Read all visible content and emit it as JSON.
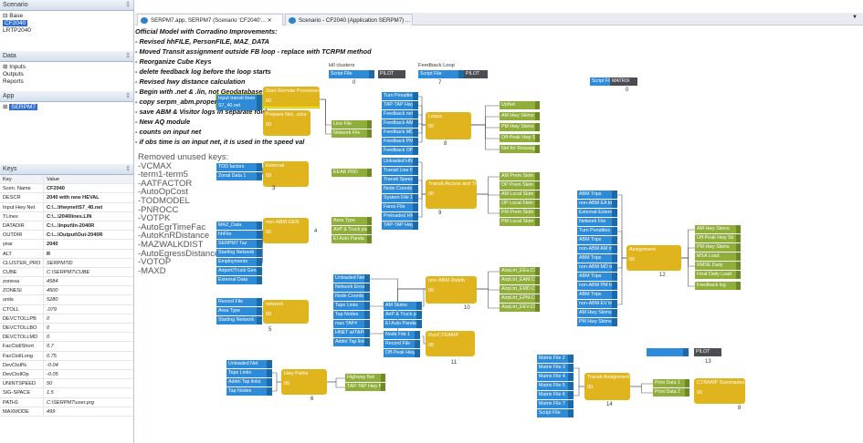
{
  "panels": {
    "scenario": "Scenario",
    "data": "Data",
    "app": "App",
    "keys": "Keys"
  },
  "scenario_tree": [
    "Base",
    "CF2040",
    "LRTP2040"
  ],
  "data_tree": [
    "Inputs",
    "Outputs",
    "Reports"
  ],
  "app_tree": [
    "SERPM7"
  ],
  "keys_header": {
    "key": "Key",
    "value": "Value"
  },
  "keys": [
    {
      "k": "Scen. Name",
      "v": "CF2040"
    },
    {
      "k": "DESCR",
      "v": "2040 with new HEVAL"
    },
    {
      "k": "Input Hwy Net",
      "v": "C:\\...\\Hwynet\\S7_40.net"
    },
    {
      "k": "TLines",
      "v": "C:\\...\\2040lines.LIN"
    },
    {
      "k": "DATADIR",
      "v": "C:\\...\\Input\\In-2040R"
    },
    {
      "k": "OUTDIR",
      "v": "C:\\...\\Output\\Out-2040R"
    },
    {
      "k": "year",
      "v": "2040"
    },
    {
      "k": "ALT",
      "v": "R"
    },
    {
      "k": "CLUSTER_PRO",
      "v": "SERPM7ID"
    },
    {
      "k": "CUBE",
      "v": "C:\\SERPM7\\CUBE"
    },
    {
      "k": "zonesa",
      "v": "4584"
    },
    {
      "k": "ZONESI",
      "v": "4500"
    },
    {
      "k": "units",
      "v": "5280"
    },
    {
      "k": "CTOLL",
      "v": ".079"
    },
    {
      "k": "DEVCTOLLPB",
      "v": "0"
    },
    {
      "k": "DEVCTOLLBO",
      "v": "0"
    },
    {
      "k": "DEVCTOLLMD",
      "v": "0"
    },
    {
      "k": "FacCtollShort",
      "v": "0.7"
    },
    {
      "k": "FacCtollLong",
      "v": "0.75"
    },
    {
      "k": "DevCtoll%",
      "v": "-0.04"
    },
    {
      "k": "DevCtollOp",
      "v": "-0.05"
    },
    {
      "k": "UNINTSPEED",
      "v": "50"
    },
    {
      "k": "SIG-SPACE",
      "v": "1.5"
    },
    {
      "k": "PATH1",
      "v": "C:\\SERPM7\\user.prg"
    },
    {
      "k": "MAXMODE",
      "v": "499"
    }
  ],
  "tabs": [
    "SERPM7.app, SERPM7 (Scenario 'CF2040'...",
    "Scenario - CF2040 (Application SERPM7) ..."
  ],
  "notes": [
    "Official Model with Corradino Improvements:",
    "- Revised hhFILE, PersonFILE, MAZ_DATA",
    "- Moved Transit assignment outside FB loop - replace with TCRPM method",
    "- Reorganize Cube Keys",
    "- delete feedback log before the loop starts",
    "- Revised hwy distance calculation",
    "- Begin with .net & .lin, not Geodatabase",
    "- copy serpm_abm.properties from {dat",
    "- save ABM & Visitor logs in separate folders",
    "- New AQ module",
    "- counts on input net",
    "- if obs time is on input net, it is used in the speed val"
  ],
  "removed_keys": [
    "Removed unused keys:",
    "-VCMAX",
    "-term1-term5",
    "-AATFACTOR",
    "-AutoOpCost",
    "-TODMODEL",
    "-PNROCC",
    "-VOTPK",
    "-AutoEgrTimeFac",
    "-AutoKnRDistance",
    "-MAZWALKDIST",
    "-AutoEgressDistance",
    "-VOTOP",
    "-MAXD"
  ],
  "labels": {
    "kill": "kill clusters",
    "fb": "Feedback Loop"
  },
  "blue": [
    "Script File",
    "Script File",
    "Script File",
    "Input transit lines",
    "S7_40.net",
    "TOD factors",
    "Zonal Data 1",
    "MAZ_Data",
    "hhFile",
    "SERPM7 Taz",
    "Starting Network",
    "Employments",
    "Airport/Truck Gen",
    "External Data",
    "Record File",
    "Area Type",
    "Starting Network",
    "Turn Penalties",
    "TAP-TAP Hwy Net",
    "Feedback net",
    "Feedback AM HS",
    "Feedback MD HS",
    "Feedback PM HS",
    "Feedback OP HS",
    "Unloaded HNET",
    "Transit Line File",
    "Transit Speed Lin",
    "Node Coords",
    "System File 1",
    "Fares File",
    "Preloaded HNET",
    "TAP-TAP Hwy Net",
    "Unloaded Net",
    "Network Errors",
    "Node Coords",
    "Taps Links",
    "Tap Nodes",
    "max TAP#",
    "HNET w/TAPs",
    "Addnl Tap links",
    "AM Skims",
    "AirP & Truck pair",
    "EI Auto Panda",
    "Node File 1",
    "Record File",
    "Off-Peak Hwy Sk",
    "Unloaded Net",
    "Taps Links",
    "Addnl Tap links",
    "Tap Nodes",
    "ABM Trips",
    "non-ABM EA trips",
    "External-External",
    "Network File",
    "Turn Penalties",
    "ABM Trips",
    "non-ABM AM trips",
    "ABM Trips",
    "non-ABM MD trips",
    "ABM Trips",
    "non-ABM PM trips",
    "ABM Trips",
    "non-ABM EV trips",
    "AM Hwy Skims",
    "PM Hwy Skims",
    "Matrix File 2",
    "Matrix File 3",
    "Matrix File 4",
    "Matrix File 5",
    "Matrix File 6",
    "Matrix File 7",
    "Script File"
  ],
  "green": [
    "Line File",
    "Network File",
    "EEAB PRD",
    "Area Type",
    "AirP & Truck pairs",
    "EI Auto Panda",
    "UpNet",
    "AM Hwy Skims",
    "PM Hwy Skims",
    "Off-Peak Hwy Sk",
    "Net for Reassign",
    "AM Prem Skim",
    "OP Prem Skim",
    "AM Local Skim",
    "OP Local Skim",
    "PM Prem Skim",
    "PM Local Skim",
    "AirpLtrt_EEa.CC",
    "AirpLtrt_EAM.CC",
    "AirpLtrt_EMD.CC",
    "AirpLtrt_EPM.CC",
    "AirpLtrt_EEV.CC",
    "Highway Net",
    "TAP-TAP Hwy Ne",
    "AM Hwy Skims",
    "Off-Peak Hwy Sk",
    "PM Hwy Skims",
    "MSA Load",
    "RMSE Daily",
    "Final Daily Load",
    "Feedback log",
    "Print Data 1",
    "Print Data 2"
  ],
  "dark": [
    "PILOT",
    "PILOT",
    "MATRIX",
    "PILOT"
  ],
  "yellow": [
    {
      "t": "Start Remote Processes",
      "s": "00"
    },
    {
      "t": "Prepare Net, .orks",
      "s": "00"
    },
    {
      "t": "External",
      "s": "00"
    },
    {
      "t": "non-ABM GEN",
      "s": "00"
    },
    {
      "t": "network",
      "s": "00"
    },
    {
      "t": "Loops",
      "s": "00"
    },
    {
      "t": "Transit Access and Transit Paths and Skims",
      "s": "00"
    },
    {
      "t": "non-ABM Distrib",
      "s": "00"
    },
    {
      "t": "RunCTRAMP",
      "s": "00"
    },
    {
      "t": "Hwy Paths",
      "s": "00"
    },
    {
      "t": "Assignment",
      "s": "00"
    },
    {
      "t": "Transit Assignment",
      "s": "00"
    },
    {
      "t": "CTRAMP Summaries",
      "s": "00"
    }
  ],
  "step_numbers": [
    "0",
    "7",
    "0",
    "3",
    "4",
    "5",
    "8",
    "9",
    "10",
    "11",
    "6",
    "12",
    "14",
    "13",
    "8"
  ]
}
